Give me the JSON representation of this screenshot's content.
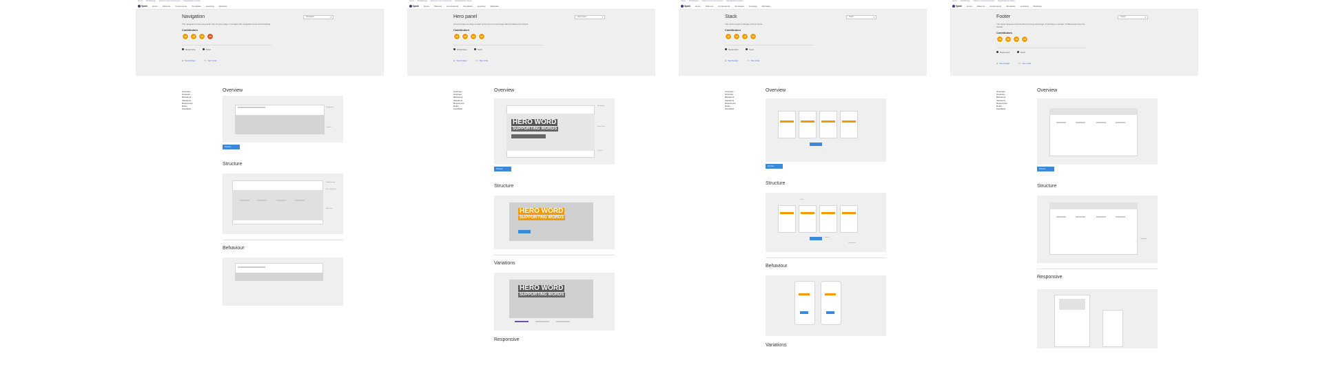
{
  "common": {
    "crumbs": [
      "Home",
      "Web/Design",
      "Patterns and Components",
      "Specifications Library"
    ],
    "nav": [
      "Home",
      "Patterns",
      "Components",
      "Templates",
      "Learning",
      "Websites"
    ],
    "logo": "Spark",
    "contributors_label": "Contributors",
    "tags": [
      "Responsive",
      "Touch"
    ],
    "design_link": "See design",
    "code_link": "See code",
    "toc": [
      "Overview",
      "Structure",
      "Behaviour",
      "Variations",
      "Responsive",
      "Rules",
      "Feedback"
    ],
    "preview_label": "Preview",
    "avatar_label": "AB"
  },
  "pages": [
    {
      "title": "Navigation",
      "select": "Navigation",
      "description": "The navigation is the area at the top of every page. It contains the navigation items and branding.",
      "sections": [
        "Overview",
        "Structure",
        "Behaviour"
      ],
      "notes": [
        "Navigation",
        "Content",
        "Global header",
        "Site navigation",
        "Sub-menu"
      ]
    },
    {
      "title": "Hero panel",
      "select": "Hero panel",
      "description": "A hero panel is a large section at the top of a web page that introduces its content.",
      "sections": [
        "Overview",
        "Structure",
        "Variations",
        "Responsive"
      ],
      "hero_word": "HERO WORD",
      "hero_sub": "SUPPORTING WORDS",
      "notes": [
        "Navigation",
        "Hero Panel",
        "Content"
      ]
    },
    {
      "title": "Stack",
      "select": "Stack",
      "description": "The card is used to display a list of items.",
      "sections": [
        "Overview",
        "Structure",
        "Behaviour",
        "Variations"
      ],
      "notes": [
        "Card",
        "Button",
        "Description"
      ]
    },
    {
      "title": "Footer",
      "select": "Footer",
      "description": "The footer appears at the bottom of every web page. It will have a number of differences from the header.",
      "sections": [
        "Overview",
        "Structure",
        "Responsive"
      ],
      "notes": [
        "Copyright"
      ]
    }
  ]
}
